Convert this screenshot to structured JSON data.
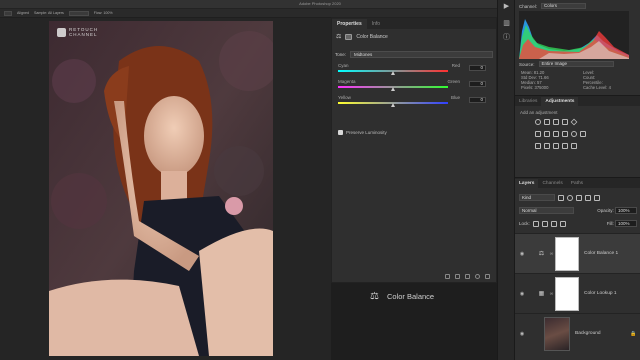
{
  "app": {
    "title": "Adobe Photoshop 2020"
  },
  "options_bar": {
    "items": [
      "Aligned",
      "Sample: All Layers",
      "Flow: 100%"
    ]
  },
  "watermark": {
    "text_line1": "RETOUCH",
    "text_line2": "CHANNEL"
  },
  "properties": {
    "tabs": [
      "Properties",
      "Info"
    ],
    "adjustment_name": "Color Balance",
    "tone_label": "Tone:",
    "tone_value": "Midtones",
    "sliders": [
      {
        "left": "Cyan",
        "right": "Red",
        "value": "0",
        "fraction": 0.5
      },
      {
        "left": "Magenta",
        "right": "Green",
        "value": "0",
        "fraction": 0.5
      },
      {
        "left": "Yellow",
        "right": "Blue",
        "value": "0",
        "fraction": 0.5
      }
    ],
    "preserve_label": "Preserve Luminosity",
    "preserve_checked": true
  },
  "big_label": "Color Balance",
  "histogram": {
    "channel_label": "Channel:",
    "channel_value": "Colors",
    "source_label": "Source:",
    "source_value": "Entire Image",
    "stats_left": [
      "Mean: 81.20",
      "Std Dev: 71.66",
      "Median: 57",
      "Pixels: 375000"
    ],
    "stats_right": [
      "Level:",
      "Count:",
      "Percentile:",
      "Cache Level: 4"
    ]
  },
  "adjustments": {
    "tabs": [
      "Libraries",
      "Adjustments"
    ],
    "add_label": "Add an adjustment"
  },
  "layers": {
    "tabs": [
      "Layers",
      "Channels",
      "Paths"
    ],
    "kind_label": "Kind",
    "blend_mode": "Normal",
    "opacity_label": "Opacity:",
    "opacity_value": "100%",
    "lock_label": "Lock:",
    "fill_label": "Fill:",
    "fill_value": "100%",
    "items": [
      {
        "name": "Color Balance 1",
        "type": "adjustment",
        "selected": true
      },
      {
        "name": "Color Lookup 1",
        "type": "adjustment",
        "selected": false
      },
      {
        "name": "Background",
        "type": "image",
        "selected": false
      }
    ]
  },
  "colors": {
    "accent": "#31a8ff",
    "panel": "#2f2f2f",
    "bg": "#1e1e1e"
  }
}
